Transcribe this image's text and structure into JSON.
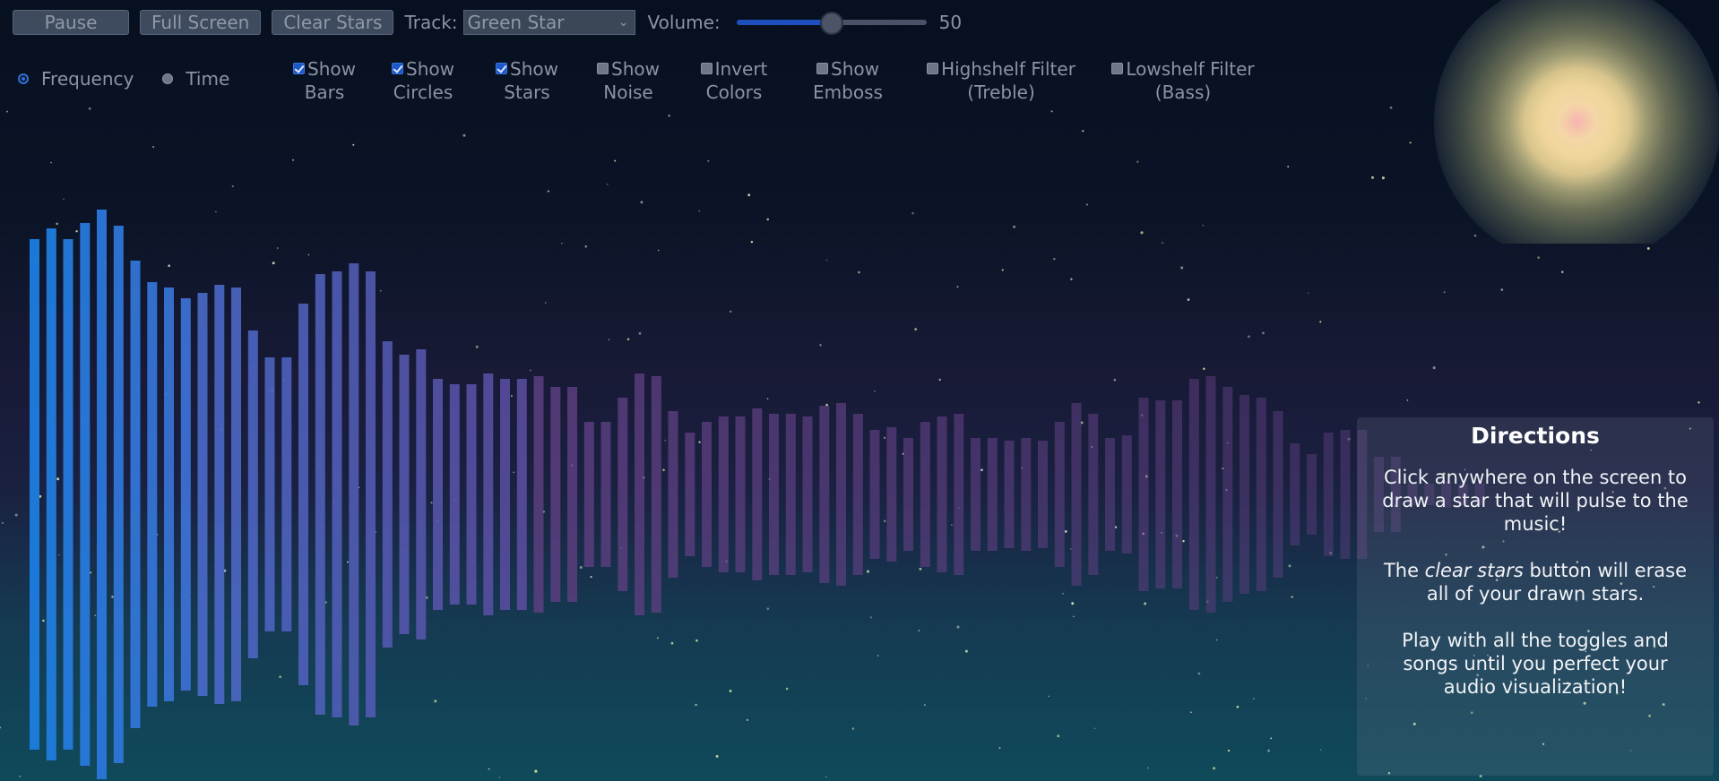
{
  "toolbar": {
    "pause_label": "Pause",
    "fullscreen_label": "Full Screen",
    "clear_stars_label": "Clear Stars",
    "track_label": "Track:",
    "track_value": "Green Star",
    "volume_label": "Volume:",
    "volume_value": "50",
    "volume_fraction": 0.5
  },
  "mode": {
    "frequency_label": "Frequency",
    "time_label": "Time",
    "selected": "Frequency"
  },
  "toggles": [
    {
      "line1": "Show",
      "line2": "Bars",
      "checked": true
    },
    {
      "line1": "Show",
      "line2": "Circles",
      "checked": true
    },
    {
      "line1": "Show",
      "line2": "Stars",
      "checked": true
    },
    {
      "line1": "Show",
      "line2": "Noise",
      "checked": false
    },
    {
      "line1": "Invert",
      "line2": "Colors",
      "checked": false
    },
    {
      "line1": "Show",
      "line2": "Emboss",
      "checked": false
    },
    {
      "line1": "Highshelf Filter",
      "line2": "(Treble)",
      "checked": false
    },
    {
      "line1": "Lowshelf Filter",
      "line2": "(Bass)",
      "checked": false
    }
  ],
  "directions": {
    "title": "Directions",
    "p1": "Click anywhere on the screen to draw a star that will pulse to the music!",
    "p2_before": "The ",
    "p2_em": "clear stars",
    "p2_after": " button will erase all of your drawn stars.",
    "p3": "Play with all the toggles and songs until you perfect your audio visualization!"
  },
  "visualizer": {
    "bar_levels": [
      0.95,
      0.99,
      0.95,
      1.01,
      1.06,
      1.0,
      0.87,
      0.79,
      0.77,
      0.73,
      0.75,
      0.78,
      0.77,
      0.61,
      0.51,
      0.51,
      0.71,
      0.82,
      0.83,
      0.86,
      0.83,
      0.57,
      0.52,
      0.54,
      0.43,
      0.41,
      0.41,
      0.45,
      0.43,
      0.43,
      0.44,
      0.4,
      0.4,
      0.27,
      0.27,
      0.36,
      0.45,
      0.44,
      0.31,
      0.23,
      0.27,
      0.29,
      0.29,
      0.32,
      0.3,
      0.3,
      0.29,
      0.33,
      0.34,
      0.3,
      0.24,
      0.25,
      0.21,
      0.27,
      0.29,
      0.3,
      0.21,
      0.21,
      0.2,
      0.21,
      0.2,
      0.27,
      0.34,
      0.3,
      0.21,
      0.22,
      0.36,
      0.35,
      0.35,
      0.43,
      0.44,
      0.4,
      0.37,
      0.36,
      0.31,
      0.19,
      0.15,
      0.23,
      0.24,
      0.24,
      0.14,
      0.14,
      0.04,
      0.04,
      0.05,
      0.04,
      0.04
    ],
    "colors": {
      "bass": "#1e7de0",
      "mid": "#5a4a9a",
      "high": "#5c3f80"
    }
  }
}
